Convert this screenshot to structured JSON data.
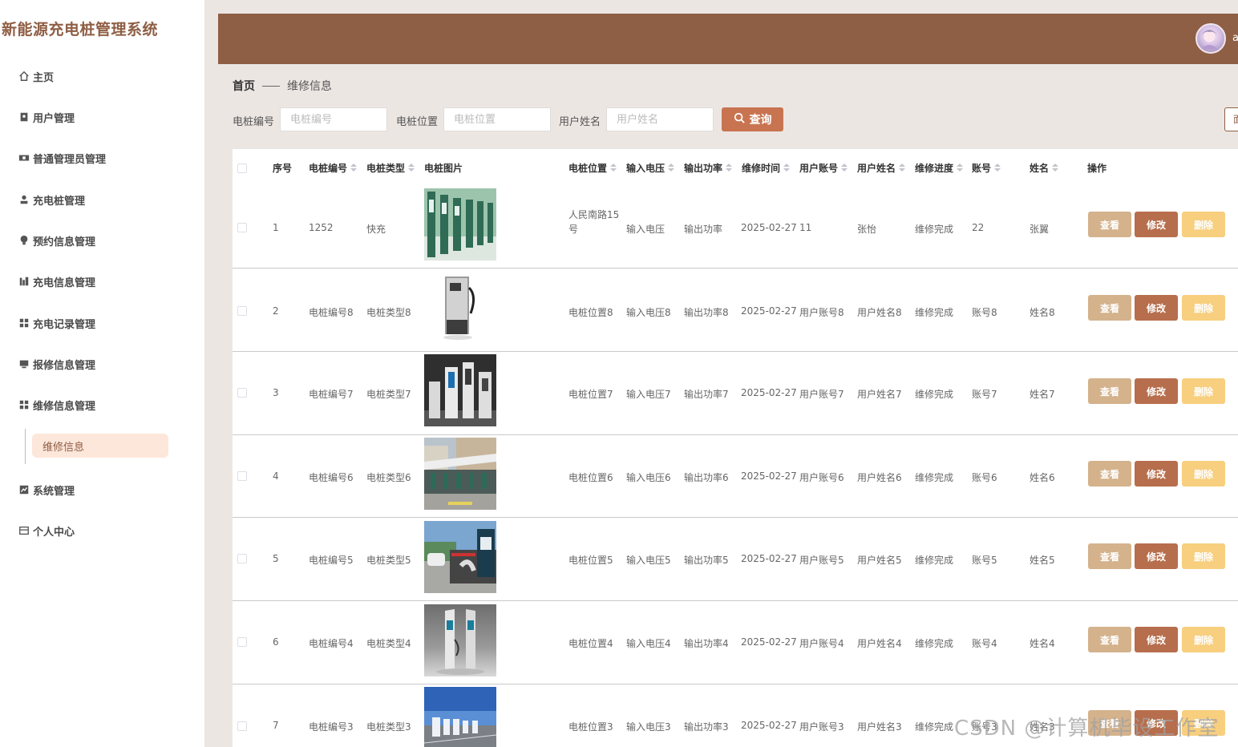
{
  "app": {
    "title": "新能源充电桩管理系统"
  },
  "sidebar": {
    "items": [
      {
        "label": "主页",
        "icon": "home-icon"
      },
      {
        "label": "用户管理",
        "icon": "user-icon"
      },
      {
        "label": "普通管理员管理",
        "icon": "admin-icon"
      },
      {
        "label": "充电桩管理",
        "icon": "person-icon"
      },
      {
        "label": "预约信息管理",
        "icon": "bulb-icon"
      },
      {
        "label": "充电信息管理",
        "icon": "chart-bars-icon"
      },
      {
        "label": "充电记录管理",
        "icon": "grid-icon"
      },
      {
        "label": "报修信息管理",
        "icon": "monitor-icon"
      },
      {
        "label": "维修信息管理",
        "icon": "grid-icon"
      },
      {
        "label": "系统管理",
        "icon": "line-chart-icon"
      },
      {
        "label": "个人中心",
        "icon": "card-icon"
      }
    ],
    "sub_item": {
      "label": "维修信息"
    }
  },
  "header": {
    "user_initial": "a"
  },
  "breadcrumb": {
    "home": "首页",
    "current": "维修信息"
  },
  "search": {
    "fields": [
      {
        "label": "电桩编号",
        "placeholder": "电桩编号"
      },
      {
        "label": "电桩位置",
        "placeholder": "电桩位置"
      },
      {
        "label": "用户姓名",
        "placeholder": "用户姓名"
      }
    ],
    "query_label": "查询",
    "right_button_label": "面"
  },
  "table": {
    "columns": [
      "序号",
      "电桩编号",
      "电桩类型",
      "电桩图片",
      "电桩位置",
      "输入电压",
      "输出功率",
      "维修时间",
      "用户账号",
      "用户姓名",
      "维修进度",
      "账号",
      "姓名",
      "操作"
    ],
    "actions": {
      "view": "查看",
      "edit": "修改",
      "delete": "删除"
    },
    "rows": [
      {
        "no": "1",
        "code": "1252",
        "type": "快充",
        "location": "人民南路15号",
        "voltage": "输入电压",
        "power": "输出功率",
        "time": "2025-02-27",
        "account": "11",
        "uname": "张怡",
        "progress": "维修完成",
        "acct": "22",
        "name": "张翼"
      },
      {
        "no": "2",
        "code": "电桩编号8",
        "type": "电桩类型8",
        "location": "电桩位置8",
        "voltage": "输入电压8",
        "power": "输出功率8",
        "time": "2025-02-27",
        "account": "用户账号8",
        "uname": "用户姓名8",
        "progress": "维修完成",
        "acct": "账号8",
        "name": "姓名8"
      },
      {
        "no": "3",
        "code": "电桩编号7",
        "type": "电桩类型7",
        "location": "电桩位置7",
        "voltage": "输入电压7",
        "power": "输出功率7",
        "time": "2025-02-27",
        "account": "用户账号7",
        "uname": "用户姓名7",
        "progress": "维修完成",
        "acct": "账号7",
        "name": "姓名7"
      },
      {
        "no": "4",
        "code": "电桩编号6",
        "type": "电桩类型6",
        "location": "电桩位置6",
        "voltage": "输入电压6",
        "power": "输出功率6",
        "time": "2025-02-27",
        "account": "用户账号6",
        "uname": "用户姓名6",
        "progress": "维修完成",
        "acct": "账号6",
        "name": "姓名6"
      },
      {
        "no": "5",
        "code": "电桩编号5",
        "type": "电桩类型5",
        "location": "电桩位置5",
        "voltage": "输入电压5",
        "power": "输出功率5",
        "time": "2025-02-27",
        "account": "用户账号5",
        "uname": "用户姓名5",
        "progress": "维修完成",
        "acct": "账号5",
        "name": "姓名5"
      },
      {
        "no": "6",
        "code": "电桩编号4",
        "type": "电桩类型4",
        "location": "电桩位置4",
        "voltage": "输入电压4",
        "power": "输出功率4",
        "time": "2025-02-27",
        "account": "用户账号4",
        "uname": "用户姓名4",
        "progress": "维修完成",
        "acct": "账号4",
        "name": "姓名4"
      },
      {
        "no": "7",
        "code": "电桩编号3",
        "type": "电桩类型3",
        "location": "电桩位置3",
        "voltage": "输入电压3",
        "power": "输出功率3",
        "time": "2025-02-27",
        "account": "用户账号3",
        "uname": "用户姓名3",
        "progress": "维修完成",
        "acct": "账号3",
        "name": "姓名3"
      }
    ]
  },
  "watermark": "CSDN @计算机毕设工作室",
  "colors": {
    "brand": "#8e5f45",
    "accent": "#c87451",
    "view": "#d4b28c",
    "edit": "#b76e4c",
    "delete": "#f7cf7e",
    "active_bg": "#fde6da"
  }
}
